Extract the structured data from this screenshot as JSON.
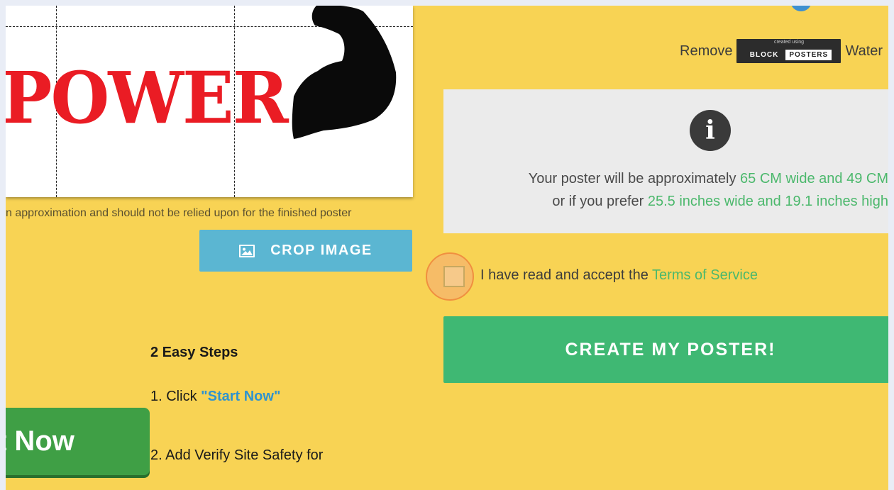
{
  "preview": {
    "text": "POWER"
  },
  "disclaimer": "n approximation and should not be relied upon for the finished poster",
  "crop_button": {
    "label": "CROP IMAGE",
    "icon": "image-icon"
  },
  "steps": {
    "title": "2 Easy Steps",
    "step1_prefix": "1. Click ",
    "step1_link": "\"Start Now\"",
    "step2": "2. Add Verify Site Safety for"
  },
  "start_now_button": {
    "label": "t Now"
  },
  "watermark": {
    "prefix": "Remove",
    "suffix": "Water",
    "badge_small": "created using",
    "badge_a": "BLOCK",
    "badge_b": "POSTERS"
  },
  "info": {
    "icon": "info-icon",
    "icon_glyph": "i",
    "line1_prefix": "Your poster will be approximately ",
    "line1_value": "65 CM wide and 49 CM",
    "line2_prefix": "or if you prefer ",
    "line2_value": "25.5 inches wide and 19.1 inches high"
  },
  "tos": {
    "text": "I have read and accept the ",
    "link": "Terms of Service",
    "checked": false
  },
  "create_button": {
    "label": "CREATE MY POSTER!"
  },
  "colors": {
    "page_background": "#f8d354",
    "accent_green": "#3fb873",
    "crop_blue": "#5bb6d2",
    "power_red": "#ea1c24",
    "start_green": "#3f9f45"
  }
}
